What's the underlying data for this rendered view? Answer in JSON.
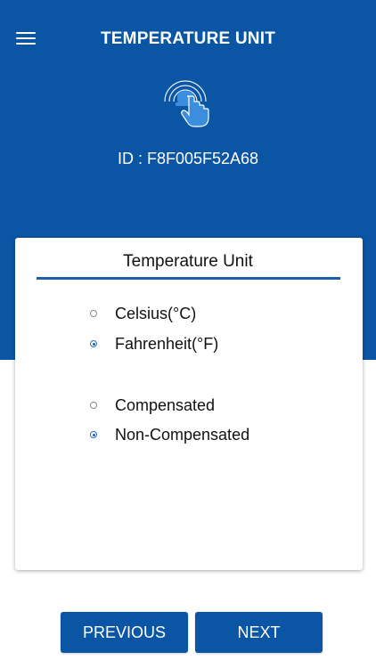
{
  "header": {
    "title": "TEMPERATURE UNIT",
    "menu_icon": "hamburger-menu-icon",
    "device_icon": "touch-signal-icon",
    "device_id": "ID : F8F005F52A68"
  },
  "card": {
    "title": "Temperature Unit",
    "unit_options": [
      {
        "label": "Celsius(°C)",
        "selected": false
      },
      {
        "label": "Fahrenheit(°F)",
        "selected": true
      }
    ],
    "compensation_options": [
      {
        "label": "Compensated",
        "selected": false
      },
      {
        "label": "Non-Compensated",
        "selected": true
      }
    ]
  },
  "buttons": {
    "previous": "PREVIOUS",
    "next": "NEXT"
  },
  "colors": {
    "primary": "#0b56a4",
    "accent": "#1c5faa",
    "icon_blue": "#3b8ede"
  }
}
